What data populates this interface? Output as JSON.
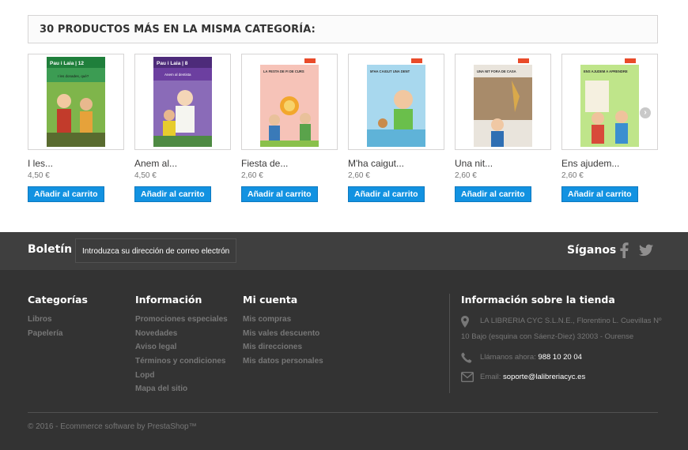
{
  "section": {
    "title": "30 PRODUCTOS MÁS EN LA MISMA CATEGORÍA:"
  },
  "products": [
    {
      "name": "I les...",
      "price": "4,50 €",
      "button": "Añadir al carrito",
      "cover_title": "Pau i Laia | 12",
      "cover_subtitle": "I les donades, què?"
    },
    {
      "name": "Anem al...",
      "price": "4,50 €",
      "button": "Añadir al carrito",
      "cover_title": "Pau i Laia | 8",
      "cover_subtitle": "Anem al dentista"
    },
    {
      "name": "Fiesta de...",
      "price": "2,60 €",
      "button": "Añadir al carrito",
      "cover_title": "LA FESTA DE FI DE CURS"
    },
    {
      "name": "M'ha caigut...",
      "price": "2,60 €",
      "button": "Añadir al carrito",
      "cover_title": "M'HA CAIGUT UNA DENT"
    },
    {
      "name": "Una nit...",
      "price": "2,60 €",
      "button": "Añadir al carrito",
      "cover_title": "UNA NIT FORA DE CASA"
    },
    {
      "name": "Ens ajudem...",
      "price": "2,60 €",
      "button": "Añadir al carrito",
      "cover_title": "ENS AJUDEM A APRENDRE"
    }
  ],
  "newsletter": {
    "title": "Boletín",
    "placeholder": "Introduzca su dirección de correo electrón"
  },
  "social": {
    "title": "Síganos"
  },
  "footer": {
    "categories": {
      "title": "Categorías",
      "items": [
        "Libros",
        "Papelería"
      ]
    },
    "info": {
      "title": "Información",
      "items": [
        "Promociones especiales",
        "Novedades",
        "Aviso legal",
        "Términos y condiciones",
        "Lopd",
        "Mapa del sitio"
      ]
    },
    "account": {
      "title": "Mi cuenta",
      "items": [
        "Mis compras",
        "Mis vales descuento",
        "Mis direcciones",
        "Mis datos personales"
      ]
    },
    "store": {
      "title": "Información sobre la tienda",
      "address_line1": "LA LIBRERIA CYC S.L.N.E., Florentino L. Cuevillas Nº",
      "address_line2": "10 Bajo (esquina con Sáenz-Diez) 32003 - Ourense",
      "phone_label": "Llámanos ahora:",
      "phone": "988 10 20 04",
      "email_label": "Email:",
      "email": "soporte@lalibreriacyc.es"
    },
    "copyright": "© 2016 - Ecommerce software by PrestaShop™"
  },
  "icons": {
    "map": "map-marker-icon",
    "phone": "phone-icon",
    "email": "envelope-icon",
    "facebook": "facebook-icon",
    "twitter": "twitter-icon",
    "go": "chevron-right-icon",
    "next": "carousel-next-icon"
  }
}
